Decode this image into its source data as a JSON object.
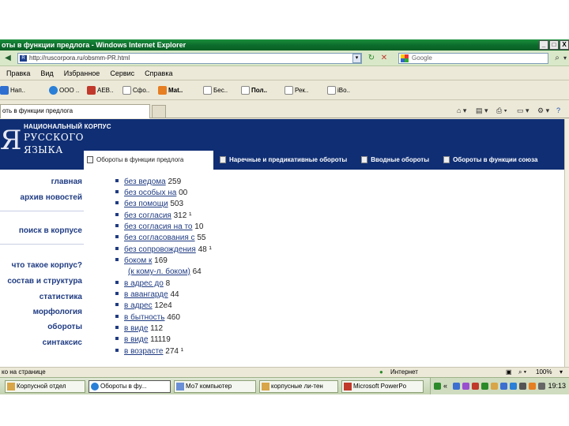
{
  "window": {
    "title": "оты в функции предлога - Windows Internet Explorer",
    "buttons": [
      "_",
      "□",
      "X"
    ]
  },
  "address_bar": {
    "url": "http://ruscorpora.ru/obsmm-PR.html",
    "search_placeholder": "Google",
    "go_icon": "refresh-stop-icon"
  },
  "menu": [
    "Правка",
    "Вид",
    "Избранное",
    "Сервис",
    "Справка"
  ],
  "links": [
    {
      "label": "Нап..",
      "color": "#2f6fd0"
    },
    {
      "label": "ООО ..",
      "color": "#2a7fd6"
    },
    {
      "label": "AEB..",
      "color": "#c0392b"
    },
    {
      "label": "Сфо..",
      "color": "#ffffff"
    },
    {
      "label": "Mat..",
      "color": "#e67e22"
    },
    {
      "label": "Бес..",
      "color": "#ffffff"
    },
    {
      "label": "Пол..",
      "color": "#ffffff"
    },
    {
      "label": "Рек..",
      "color": "#ffffff"
    },
    {
      "label": "iBo..",
      "color": "#ffffff"
    }
  ],
  "tab": {
    "label": "оть в функции предлога"
  },
  "site": {
    "logo_letter": "Я",
    "logo_small": "НАЦИОНАЛЬНЫЙ КОРПУС",
    "logo_line1": "РУССКОГО",
    "logo_line2": "ЯЗЫКА",
    "topnav": [
      "Обороты в функции предлога",
      "Наречные и предикативные обороты",
      "Вводные обороты",
      "Обороты в функции союза"
    ],
    "sidenav": [
      "главная",
      "архив новостей",
      "поиск в корпусе",
      "что такое корпус?",
      "состав и структура",
      "статистика",
      "морфология",
      "обороты",
      "синтаксис"
    ],
    "entries": [
      {
        "phrase": "без ведома",
        "count": "259"
      },
      {
        "phrase": "без особых на",
        "count": "00"
      },
      {
        "phrase": "без помощи",
        "count": "503"
      },
      {
        "phrase": "без согласия",
        "count": "312 ¹"
      },
      {
        "phrase": "без согласия на то",
        "count": "10"
      },
      {
        "phrase": "без согласования с",
        "count": "55"
      },
      {
        "phrase": "без сопровождения",
        "count": "48 ¹"
      },
      {
        "phrase": "боком к",
        "count": "169"
      },
      {
        "phrase": "(к кому-л. боком)",
        "count": "64"
      },
      {
        "phrase": "в адрес до",
        "count": "8"
      },
      {
        "phrase": "в авангарде",
        "count": "44"
      },
      {
        "phrase": "в адрес",
        "count": "12e4"
      },
      {
        "phrase": "в бытность",
        "count": "460"
      },
      {
        "phrase": "в виде",
        "count": "112"
      },
      {
        "phrase": "в виде",
        "count": "11119"
      },
      {
        "phrase": "в возрасте",
        "count": "274 ¹"
      }
    ]
  },
  "status": {
    "left": "ко на странице",
    "zone": "Интернет",
    "zoom": "100%"
  },
  "taskbar": {
    "tasks": [
      "Корпусной отдел",
      "Обороты в фу...",
      "Мо7 компьютер",
      "корпусные ли-тен",
      "Microsoft PowerPo"
    ],
    "clock": "19:13"
  },
  "colors": {
    "title_green": "#0b6b2b",
    "site_blue": "#0f2e74",
    "link_blue": "#1f3b82"
  }
}
